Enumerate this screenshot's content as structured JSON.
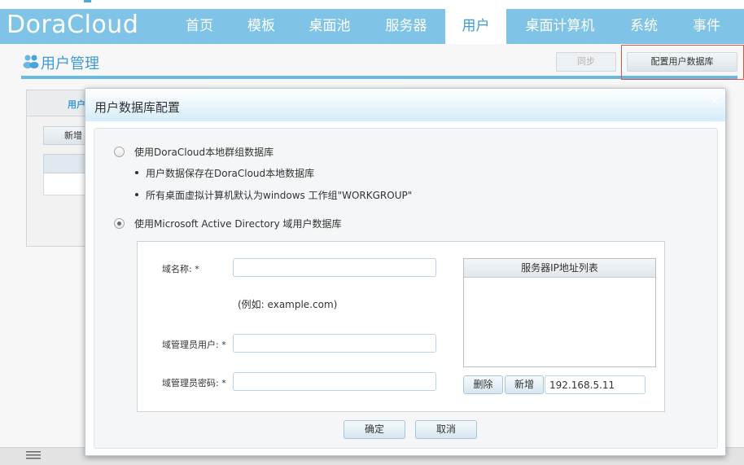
{
  "app": {
    "logo": "DoraCloud"
  },
  "nav": {
    "items": [
      "首页",
      "模板",
      "桌面池",
      "服务器",
      "用户",
      "桌面计算机",
      "系统",
      "事件"
    ],
    "active": "用户"
  },
  "page": {
    "title": "用户管理",
    "sync_button": "同步",
    "config_button": "配置用户数据库"
  },
  "background": {
    "tab_label": "用户",
    "add_button": "新增"
  },
  "dialog": {
    "title": "用户数据库配置",
    "close": "×",
    "option_local": {
      "label": "使用DoraCloud本地群组数据库",
      "selected": false,
      "notes": [
        "用户数据保存在DoraCloud本地数据库",
        "所有桌面虚拟计算机默认为windows 工作组\"WORKGROUP\""
      ]
    },
    "option_ad": {
      "label": "使用Microsoft Active Directory 域用户数据库",
      "selected": true
    },
    "form": {
      "domain_label": "域名称: *",
      "domain_value": "",
      "domain_hint": "(例如: example.com)",
      "admin_user_label": "域管理员用户: *",
      "admin_user_value": "",
      "admin_pass_label": "域管理员密码: *",
      "admin_pass_value": ""
    },
    "ip_list": {
      "header": "服务器IP地址列表",
      "items": [],
      "delete_button": "删除",
      "add_button": "新增",
      "ip_input_value": "192.168.5.11"
    },
    "ok_button": "确定",
    "cancel_button": "取消"
  },
  "colors": {
    "nav_bg": "#7fc3e6",
    "accent": "#3d9bd4",
    "highlight_border": "#e05050"
  }
}
